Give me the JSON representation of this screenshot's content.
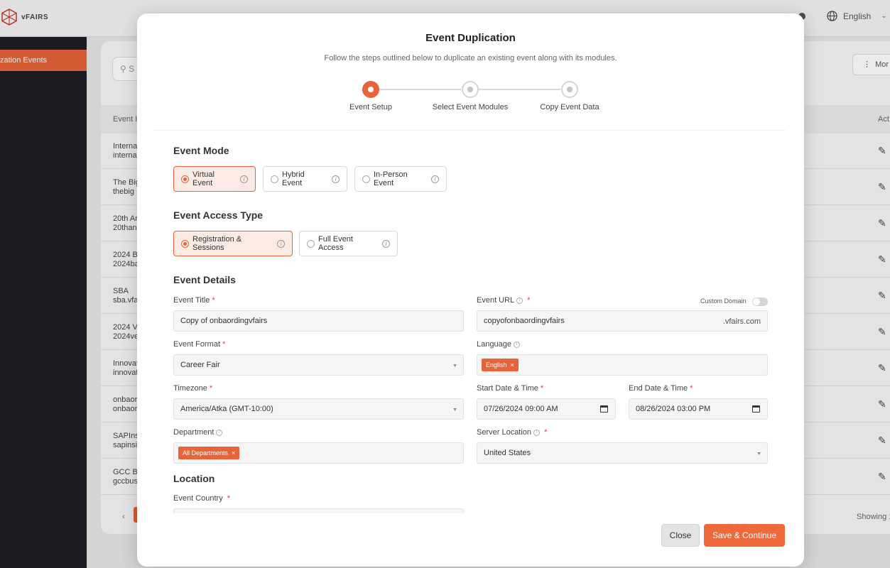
{
  "app": {
    "brand": "vFAIRS",
    "language": "English",
    "sidebar_active": "zation Events",
    "search_placeholder": "S",
    "more_label": "Mor",
    "table_headers": [
      "Event I",
      "Act"
    ],
    "rows": [
      {
        "title": "Interna",
        "sub": "interna"
      },
      {
        "title": "The Big",
        "sub": "thebig"
      },
      {
        "title": "20th An",
        "sub": "20than"
      },
      {
        "title": "2024 Ba",
        "sub": "2024ba"
      },
      {
        "title": "SBA",
        "sub": "sba.vfa"
      },
      {
        "title": "2024 Vi",
        "sub": "2024ve"
      },
      {
        "title": "Innovat",
        "sub": "innovat"
      },
      {
        "title": "onbaor",
        "sub": "onbaor"
      },
      {
        "title": "SAPIns",
        "sub": "sapinsi"
      },
      {
        "title": "GCC Bu",
        "sub": "gccbus"
      }
    ],
    "showing_label": "Showing 1"
  },
  "modal": {
    "title": "Event Duplication",
    "subtitle": "Follow the steps outlined below to duplicate an existing event along with its modules.",
    "steps": [
      {
        "label": "Event Setup",
        "state": "active"
      },
      {
        "label": "Select Event Modules",
        "state": "idle"
      },
      {
        "label": "Copy Event Data",
        "state": "idle"
      }
    ],
    "event_mode": {
      "title": "Event Mode",
      "options": [
        "Virtual Event",
        "Hybrid Event",
        "In-Person Event"
      ],
      "selected": "Virtual Event"
    },
    "access_type": {
      "title": "Event Access Type",
      "options": [
        "Registration & Sessions",
        "Full Event Access"
      ],
      "selected": "Registration & Sessions"
    },
    "details": {
      "title": "Event Details",
      "event_title_label": "Event Title",
      "event_title_value": "Copy of onbaordingvfairs",
      "event_url_label": "Event URL",
      "event_url_value": "copyofonbaordingvfairs",
      "event_url_suffix": ".vfairs.com",
      "custom_domain_label": "Custom Domain",
      "format_label": "Event Format",
      "format_value": "Career Fair",
      "language_label": "Language",
      "language_tag": "English",
      "timezone_label": "Timezone",
      "timezone_value": "America/Atka (GMT-10:00)",
      "start_label": "Start Date & Time",
      "start_value": "07/26/2024 09:00 AM",
      "end_label": "End Date & Time",
      "end_value": "08/26/2024 03:00 PM",
      "department_label": "Department",
      "department_tag": "All Departments",
      "server_label": "Server Location",
      "server_value": "United States"
    },
    "location": {
      "title": "Location",
      "country_label": "Event Country"
    },
    "buttons": {
      "close": "Close",
      "save": "Save & Continue"
    }
  }
}
